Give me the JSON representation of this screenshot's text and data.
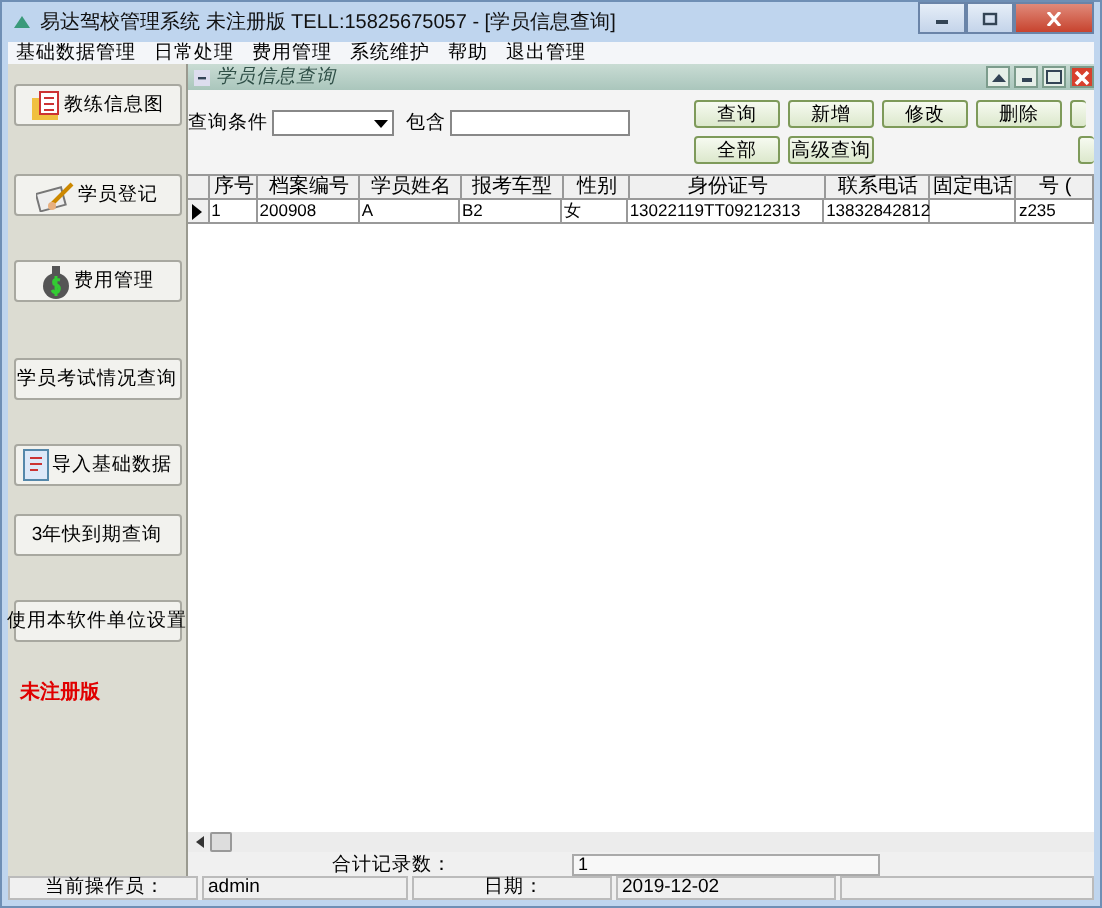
{
  "window": {
    "title": "易达驾校管理系统 未注册版 TELL:15825675057  - [学员信息查询]"
  },
  "menu": [
    "基础数据管理",
    "日常处理",
    "费用管理",
    "系统维护",
    "帮助",
    "退出管理"
  ],
  "sidebar": {
    "buttons": [
      {
        "label": "教练信息图",
        "kind": "chart"
      },
      {
        "label": "学员登记",
        "kind": "pen"
      },
      {
        "label": "费用管理",
        "kind": "money"
      },
      {
        "label": "学员考试情况查询",
        "kind": "plain"
      },
      {
        "label": "导入基础数据",
        "kind": "import"
      },
      {
        "label": "3年快到期查询",
        "kind": "plain"
      },
      {
        "label": "使用本软件单位设置",
        "kind": "plain"
      }
    ],
    "notice": "未注册版"
  },
  "child_window": {
    "title": "学员信息查询"
  },
  "query": {
    "condition_label": "查询条件",
    "contains_label": "包含",
    "buttons_row_1": [
      "查询",
      "新增",
      "修改",
      "删除"
    ],
    "buttons_row_2": [
      "全部",
      "高级查询"
    ]
  },
  "table": {
    "columns": [
      "序号",
      "档案编号",
      "学员姓名",
      "报考车型",
      "性别",
      "身份证号",
      "联系电话",
      "固定电话",
      "号 ("
    ],
    "rows": [
      {
        "selected": true,
        "cells": [
          "1",
          "200908",
          "A",
          "B2",
          "女",
          "13022119TT09212313",
          "13832842812",
          "",
          "z235"
        ]
      }
    ]
  },
  "summary": {
    "label": "合计记录数：",
    "value": "1"
  },
  "status_bar": {
    "operator_label": "当前操作员：",
    "operator": "admin",
    "date_label": "日期：",
    "date": "2019-12-02"
  }
}
